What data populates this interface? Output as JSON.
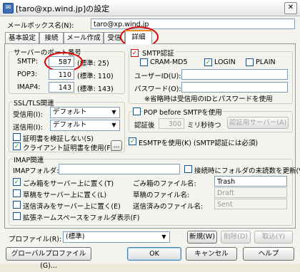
{
  "window": {
    "title": "[taro@xp.wind.jp]の設定",
    "close_label": "✕"
  },
  "mailbox": {
    "label": "メールボックス名(N):",
    "value": "taro@xp.wind.jp"
  },
  "tabs": [
    {
      "label": "基本設定"
    },
    {
      "label": "接続"
    },
    {
      "label": "メール作成"
    },
    {
      "label": "受信"
    },
    {
      "label": "詳細",
      "active": true
    }
  ],
  "ports": {
    "title": "サーバーのポート番号",
    "smtp": {
      "label": "SMTP:",
      "value": "587",
      "default": "(標準: 25)"
    },
    "pop3": {
      "label": "POP3:",
      "value": "110",
      "default": "(標準: 110)"
    },
    "imap4": {
      "label": "IMAP4:",
      "value": "143",
      "default": "(標準: 143)"
    }
  },
  "smtp_auth": {
    "title": "SMTP認証",
    "cram_md5": "CRAM-MD5",
    "login": "LOGIN",
    "plain": "PLAIN",
    "user_label": "ユーザーID(U):",
    "password_label": "パスワード(O):",
    "note": "※省略時は受信用のIDとパスワードを使用"
  },
  "ssl": {
    "title": "SSL/TLS関連",
    "receive_label": "受信用(I):",
    "receive_value": "デフォルト",
    "send_label": "送信用(I):",
    "send_value": "デフォルト",
    "verify_cert": "証明書を検証しない(S)",
    "client_cert": "クライアント証明書を使用(F)",
    "browse_label": "..."
  },
  "pop_before": {
    "title": "POP before SMTPを使用",
    "auth_after": "認証後",
    "ms_value": "300",
    "ms_label": "ミリ秒待つ",
    "server_button": "認証用サーバー(A)"
  },
  "esmtp_label": "ESMTPを使用(K) (SMTP認証には必須)",
  "imap": {
    "title": "IMAP関連",
    "folder_label": "IMAPフォルダ:",
    "unread_on_connect": "接続時にフォルダの未読数を更新(V)",
    "trash_on_server": "ごみ箱をサーバー上に置く(T)",
    "drafts_on_server": "草稿をサーバー上に置く(L)",
    "sent_on_server": "送信済みをサーバー上に置く(E)",
    "extend_namespace": "拡張ネームスペースをフォルダ表示(F)",
    "trash_label": "ごみ箱のファイル名:",
    "trash_value": "Trash",
    "drafts_label": "草稿のファイル名:",
    "drafts_value": "Draft",
    "sent_label": "送信済みのファイル名:",
    "sent_value": "Sent"
  },
  "profile": {
    "label": "プロファイル(R):",
    "value": "(標準)",
    "new_button": "新規(W)",
    "delete_button": "削除(D)",
    "rename_button": "取込(Y)"
  },
  "footer": {
    "global_profile": "グローバルプロファイル(G)...",
    "ok": "OK",
    "cancel": "キャンセル",
    "help": "ヘルプ"
  },
  "colors": {
    "highlight": "#e00000",
    "check": "#21a121",
    "focus": "#3c7fb1"
  }
}
